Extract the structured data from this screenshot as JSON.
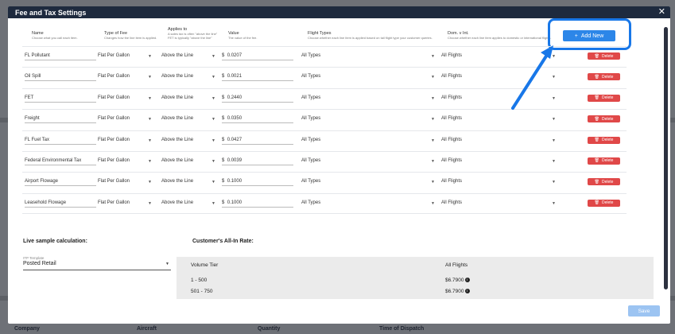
{
  "modal": {
    "title": "Fee and Tax Settings",
    "close_glyph": "✕"
  },
  "columns": {
    "name": {
      "title": "Name",
      "desc": "Choose what you call each item."
    },
    "type": {
      "title": "Type of Fee",
      "desc": "Changes how the line item is applied."
    },
    "applies": {
      "title": "Applies to",
      "desc1": "A sales tax is often \"above the line\"",
      "desc2": "FET is typically \"above the line\""
    },
    "value": {
      "title": "Value",
      "desc": "The value of the fee."
    },
    "flight": {
      "title": "Flight Types",
      "desc": "Choose whether each line item is applied based on tail flight type your customer queries."
    },
    "dom": {
      "title": "Dom. v Int.",
      "desc": "Choose whether each line item applies to domestic or international flights."
    }
  },
  "rows": [
    {
      "name": "FL Pollutant",
      "type": "Flat Per Gallon",
      "applies": "Above the Line",
      "currency": "$",
      "value": "0.0207",
      "flight": "All Types",
      "dom": "All Flights",
      "delete": "Delete"
    },
    {
      "name": "Oil Spill",
      "type": "Flat Per Gallon",
      "applies": "Above the Line",
      "currency": "$",
      "value": "0.0021",
      "flight": "All Types",
      "dom": "All Flights",
      "delete": "Delete"
    },
    {
      "name": "FET",
      "type": "Flat Per Gallon",
      "applies": "Above the Line",
      "currency": "$",
      "value": "0.2440",
      "flight": "All Types",
      "dom": "All Flights",
      "delete": "Delete"
    },
    {
      "name": "Freight",
      "type": "Flat Per Gallon",
      "applies": "Above the Line",
      "currency": "$",
      "value": "0.0350",
      "flight": "All Types",
      "dom": "All Flights",
      "delete": "Delete"
    },
    {
      "name": "FL Fuel Tax",
      "type": "Flat Per Gallon",
      "applies": "Above the Line",
      "currency": "$",
      "value": "0.0427",
      "flight": "All Types",
      "dom": "All Flights",
      "delete": "Delete"
    },
    {
      "name": "Federal Environmental Tax",
      "type": "Flat Per Gallon",
      "applies": "Above the Line",
      "currency": "$",
      "value": "0.0039",
      "flight": "All Types",
      "dom": "All Flights",
      "delete": "Delete"
    },
    {
      "name": "Airport Flowage",
      "type": "Flat Per Gallon",
      "applies": "Above the Line",
      "currency": "$",
      "value": "0.1000",
      "flight": "All Types",
      "dom": "All Flights",
      "delete": "Delete"
    },
    {
      "name": "Leasehold Flowage",
      "type": "Flat Per Gallon",
      "applies": "Above the Line",
      "currency": "$",
      "value": "0.1000",
      "flight": "All Types",
      "dom": "All Flights",
      "delete": "Delete"
    }
  ],
  "add_button": {
    "label": "Add New",
    "glyph": "+"
  },
  "live": {
    "title": "Live sample calculation:",
    "itp_label": "ITP Template",
    "itp_value": "Posted Retail"
  },
  "customer": {
    "title": "Customer's All-In Rate:",
    "col_tier": "Volume Tier",
    "col_flights": "All Flights",
    "tiers": [
      {
        "range": "1 - 500",
        "rate": "$6.7900"
      },
      {
        "range": "501 - 750",
        "rate": "$6.7900"
      }
    ]
  },
  "save": {
    "label": "Save"
  },
  "background": {
    "company": "Company",
    "aircraft": "Aircraft",
    "quantity": "Quantity",
    "dispatch": "Time of Dispatch"
  },
  "colors": {
    "header": "#1e2a3e",
    "accent": "#2c86e8",
    "danger": "#e04848",
    "highlight": "#1877e8"
  },
  "icons": {
    "delete": "trash-icon",
    "add": "plus-icon",
    "close": "close-icon",
    "info": "info-icon",
    "dropdown": "chevron-down-icon"
  }
}
